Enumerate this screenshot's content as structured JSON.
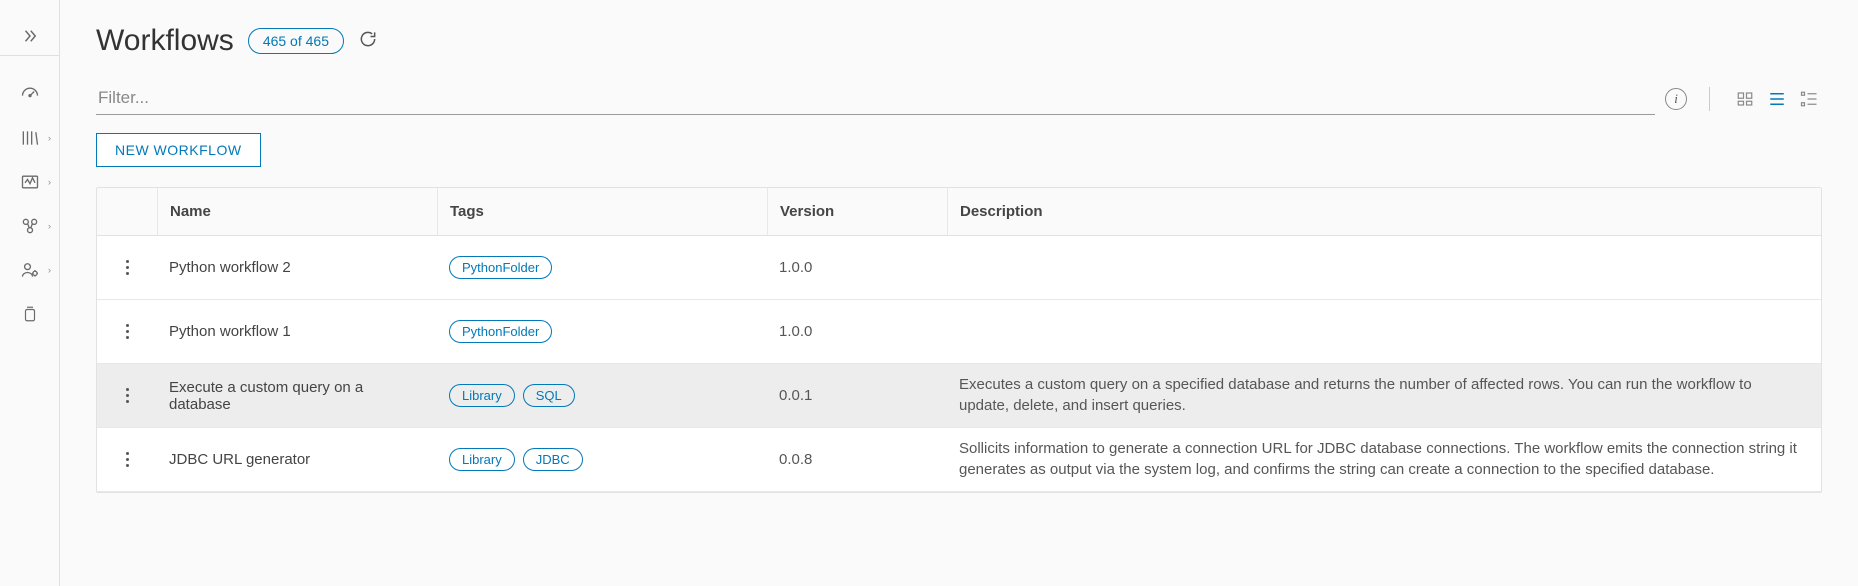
{
  "page_title": "Workflows",
  "count_badge": "465 of 465",
  "filter_placeholder": "Filter...",
  "new_button": "NEW WORKFLOW",
  "columns": {
    "name": "Name",
    "tags": "Tags",
    "version": "Version",
    "description": "Description"
  },
  "rows": [
    {
      "name": "Python workflow 2",
      "tags": [
        "PythonFolder"
      ],
      "version": "1.0.0",
      "description": "",
      "selected": false
    },
    {
      "name": "Python workflow 1",
      "tags": [
        "PythonFolder"
      ],
      "version": "1.0.0",
      "description": "",
      "selected": false
    },
    {
      "name": "Execute a custom query on a database",
      "tags": [
        "Library",
        "SQL"
      ],
      "version": "0.0.1",
      "description": "Executes a custom query on a specified database and returns the number of affected rows. You can run the workflow to update, delete, and insert queries.",
      "selected": true
    },
    {
      "name": "JDBC URL generator",
      "tags": [
        "Library",
        "JDBC"
      ],
      "version": "0.0.8",
      "description": "Sollicits information to generate a connection URL for JDBC database connections. The workflow emits the connection string it generates as output via the system log, and confirms the string can create a connection to the specified database.",
      "selected": false
    }
  ]
}
